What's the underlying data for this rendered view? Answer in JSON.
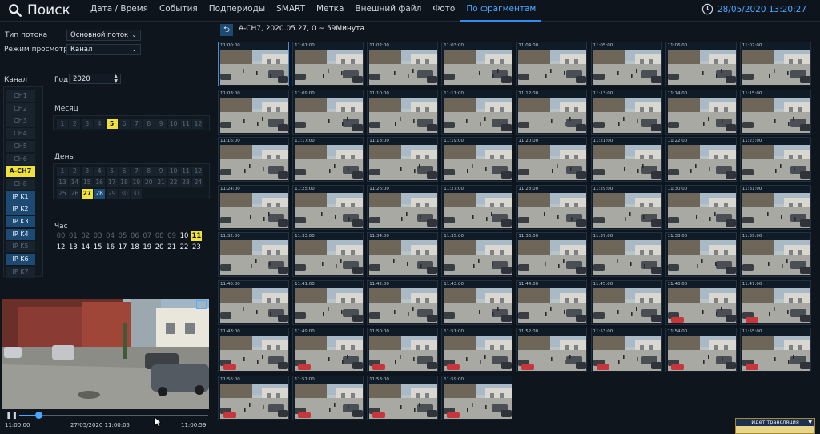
{
  "app": {
    "title": "Поиск"
  },
  "nav": {
    "tabs": [
      {
        "label": "Дата / Время"
      },
      {
        "label": "События"
      },
      {
        "label": "Подпериоды"
      },
      {
        "label": "SMART"
      },
      {
        "label": "Метка"
      },
      {
        "label": "Внешний файл"
      },
      {
        "label": "Фото"
      },
      {
        "label": "По фрагментам"
      }
    ],
    "active_index": 7
  },
  "datetime": "28/05/2020 13:20:27",
  "filters": {
    "stream_label": "Тип потока",
    "stream_value": "Основной поток",
    "view_label": "Режим просмотра",
    "view_value": "Канал",
    "year_label": "Год",
    "year_value": "2020",
    "channel_label": "Канал",
    "month_label": "Месяц",
    "day_label": "День",
    "hour_label": "Час"
  },
  "channels": [
    {
      "label": "CH1",
      "state": "off"
    },
    {
      "label": "CH2",
      "state": "off"
    },
    {
      "label": "CH3",
      "state": "off"
    },
    {
      "label": "CH4",
      "state": "off"
    },
    {
      "label": "CH5",
      "state": "off"
    },
    {
      "label": "CH6",
      "state": "off"
    },
    {
      "label": "A-CH7",
      "state": "selected"
    },
    {
      "label": "CH8",
      "state": "off"
    },
    {
      "label": "IP K1",
      "state": "on"
    },
    {
      "label": "IP K2",
      "state": "on"
    },
    {
      "label": "IP K3",
      "state": "on"
    },
    {
      "label": "IP K4",
      "state": "on"
    },
    {
      "label": "IP K5",
      "state": "off"
    },
    {
      "label": "IP K6",
      "state": "on"
    },
    {
      "label": "IP K7",
      "state": "off"
    }
  ],
  "months": [
    "1",
    "2",
    "3",
    "4",
    "5",
    "6",
    "7",
    "8",
    "9",
    "10",
    "11",
    "12"
  ],
  "selected_month": "5",
  "days": [
    "1",
    "2",
    "3",
    "4",
    "5",
    "6",
    "7",
    "8",
    "9",
    "10",
    "11",
    "12",
    "13",
    "14",
    "15",
    "16",
    "17",
    "18",
    "19",
    "20",
    "21",
    "22",
    "23",
    "24",
    "25",
    "26",
    "27",
    "28",
    "29",
    "30",
    "31"
  ],
  "selected_day": "27",
  "available_days": [
    "27",
    "28"
  ],
  "hours": [
    "00",
    "01",
    "02",
    "03",
    "04",
    "05",
    "06",
    "07",
    "08",
    "09",
    "10",
    "11",
    "12",
    "13",
    "14",
    "15",
    "16",
    "17",
    "18",
    "19",
    "20",
    "21",
    "22",
    "23"
  ],
  "selected_hour": "11",
  "available_hours": [
    "10",
    "11",
    "12",
    "13",
    "14",
    "15",
    "16",
    "17",
    "18",
    "19",
    "20",
    "21",
    "22",
    "23"
  ],
  "fragments_header": "A-CH7,   2020.05.27,   0 ~ 59Минута",
  "fragments": [
    "11:00:00",
    "11:01:00",
    "11:02:00",
    "11:03:00",
    "11:04:00",
    "11:05:00",
    "11:06:00",
    "11:07:00",
    "11:08:00",
    "11:09:00",
    "11:10:00",
    "11:11:00",
    "11:12:00",
    "11:13:00",
    "11:14:00",
    "11:15:00",
    "11:16:00",
    "11:17:00",
    "11:18:00",
    "11:19:00",
    "11:20:00",
    "11:21:00",
    "11:22:00",
    "11:23:00",
    "11:24:00",
    "11:25:00",
    "11:26:00",
    "11:27:00",
    "11:28:00",
    "11:29:00",
    "11:30:00",
    "11:31:00",
    "11:32:00",
    "11:33:00",
    "11:34:00",
    "11:35:00",
    "11:36:00",
    "11:37:00",
    "11:38:00",
    "11:39:00",
    "11:40:00",
    "11:41:00",
    "11:42:00",
    "11:43:00",
    "11:44:00",
    "11:45:00",
    "11:46:00",
    "11:47:00",
    "11:48:00",
    "11:49:00",
    "11:50:00",
    "11:51:00",
    "11:52:00",
    "11:53:00",
    "11:54:00",
    "11:55:00",
    "11:56:00",
    "11:57:00",
    "11:58:00",
    "11:59:00"
  ],
  "playback": {
    "start": "11:00:00",
    "current": "27/05/2020 11:00:05",
    "end": "11:00:59",
    "progress": 0.1
  },
  "status": {
    "text": "Идет трансляция"
  },
  "colors": {
    "accent": "#4aa7ff",
    "selected": "#f0e23a",
    "active": "#1d4a73"
  }
}
